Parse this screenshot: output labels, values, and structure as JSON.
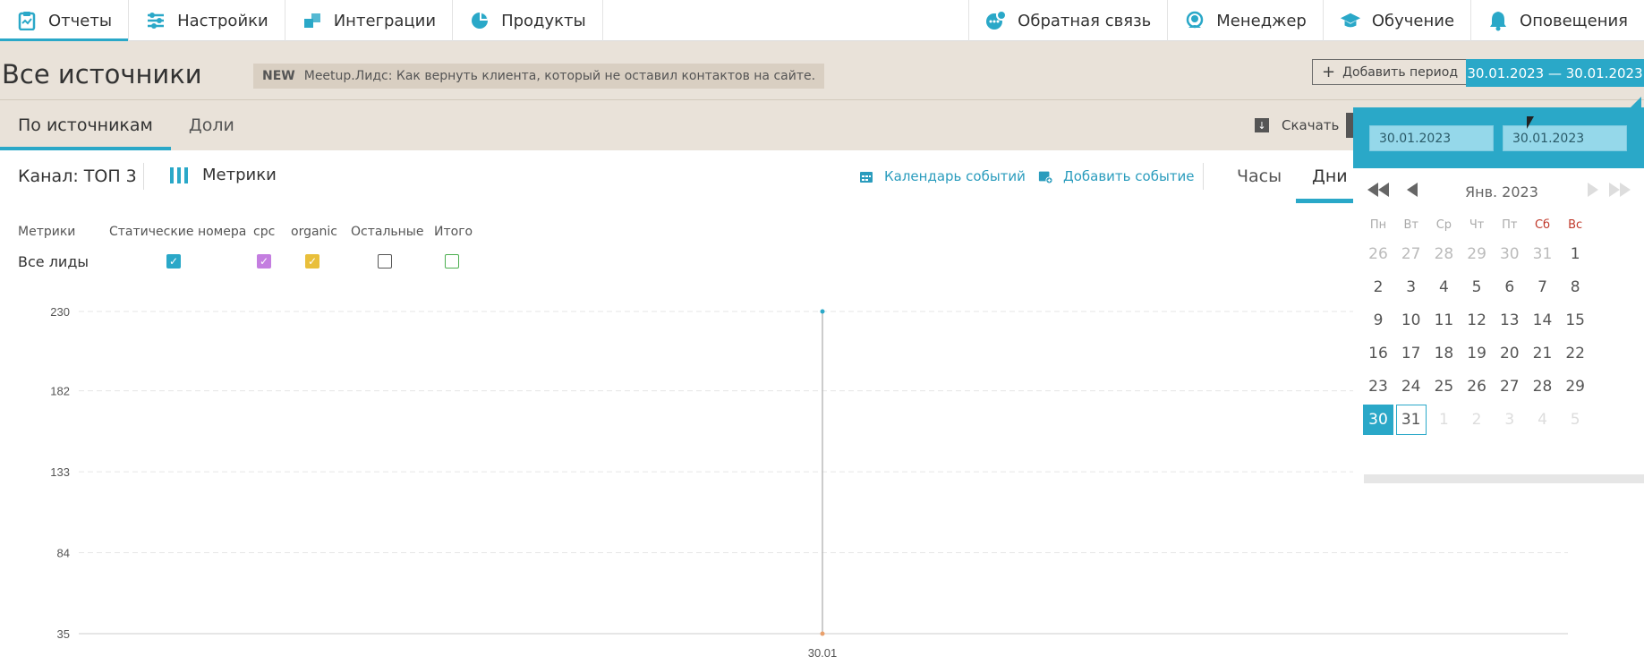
{
  "nav": {
    "left": [
      {
        "label": "Отчеты",
        "icon": "clipboard-icon"
      },
      {
        "label": "Настройки",
        "icon": "sliders-icon"
      },
      {
        "label": "Интеграции",
        "icon": "puzzle-icon"
      },
      {
        "label": "Продукты",
        "icon": "pie-icon"
      }
    ],
    "right": [
      {
        "label": "Обратная связь",
        "icon": "chat-gear-icon"
      },
      {
        "label": "Менеджер",
        "icon": "headset-icon"
      },
      {
        "label": "Обучение",
        "icon": "graduation-cap-icon"
      },
      {
        "label": "Оповещения",
        "icon": "bell-icon"
      }
    ]
  },
  "header": {
    "title": "Все источники",
    "news_tag": "NEW",
    "news_text": "Meetup.Лидс: Как вернуть клиента, который не оставил контактов на сайте.",
    "add_period": "Добавить период",
    "date_range": "30.01.2023  —  30.01.2023",
    "tabs": [
      "По источникам",
      "Доли"
    ],
    "download": "Скачать"
  },
  "toolbar": {
    "channel": "Канал: ТОП 3",
    "metrics": "Метрики",
    "calendar_events": "Календарь событий",
    "add_event": "Добавить событие",
    "hours": "Часы",
    "days": "Дни"
  },
  "legend": {
    "header_label": "Метрики",
    "columns": [
      "Статические номера",
      "cpc",
      "organic",
      "Остальные",
      "Итого"
    ],
    "row_label": "Все лиды",
    "checked": [
      true,
      true,
      true,
      false,
      false
    ]
  },
  "colors": {
    "accent": "#2aa8c8",
    "cpc": "#c47ee0",
    "organic": "#e9bf3b",
    "total": "#4caf50",
    "header_bg": "#e9e2d9"
  },
  "chart_data": {
    "type": "line",
    "x": [
      "30.01"
    ],
    "y_ticks": [
      35,
      84,
      133,
      182,
      230
    ],
    "ylim": [
      35,
      230
    ],
    "series": [
      {
        "values": [
          230
        ],
        "color": "#2aa8c8"
      },
      {
        "values": [
          35
        ],
        "color": "#e9a06b"
      }
    ],
    "grid": true
  },
  "calendar": {
    "from": "30.01.2023",
    "to": "30.01.2023",
    "month": "Янв. 2023",
    "weekdays": [
      "Пн",
      "Вт",
      "Ср",
      "Чт",
      "Пт",
      "Сб",
      "Вс"
    ],
    "weeks": [
      [
        "26",
        "27",
        "28",
        "29",
        "30",
        "31",
        "1"
      ],
      [
        "2",
        "3",
        "4",
        "5",
        "6",
        "7",
        "8"
      ],
      [
        "9",
        "10",
        "11",
        "12",
        "13",
        "14",
        "15"
      ],
      [
        "16",
        "17",
        "18",
        "19",
        "20",
        "21",
        "22"
      ],
      [
        "23",
        "24",
        "25",
        "26",
        "27",
        "28",
        "29"
      ],
      [
        "30",
        "31",
        "1",
        "2",
        "3",
        "4",
        "5"
      ]
    ],
    "selected": "30",
    "today": "31"
  }
}
